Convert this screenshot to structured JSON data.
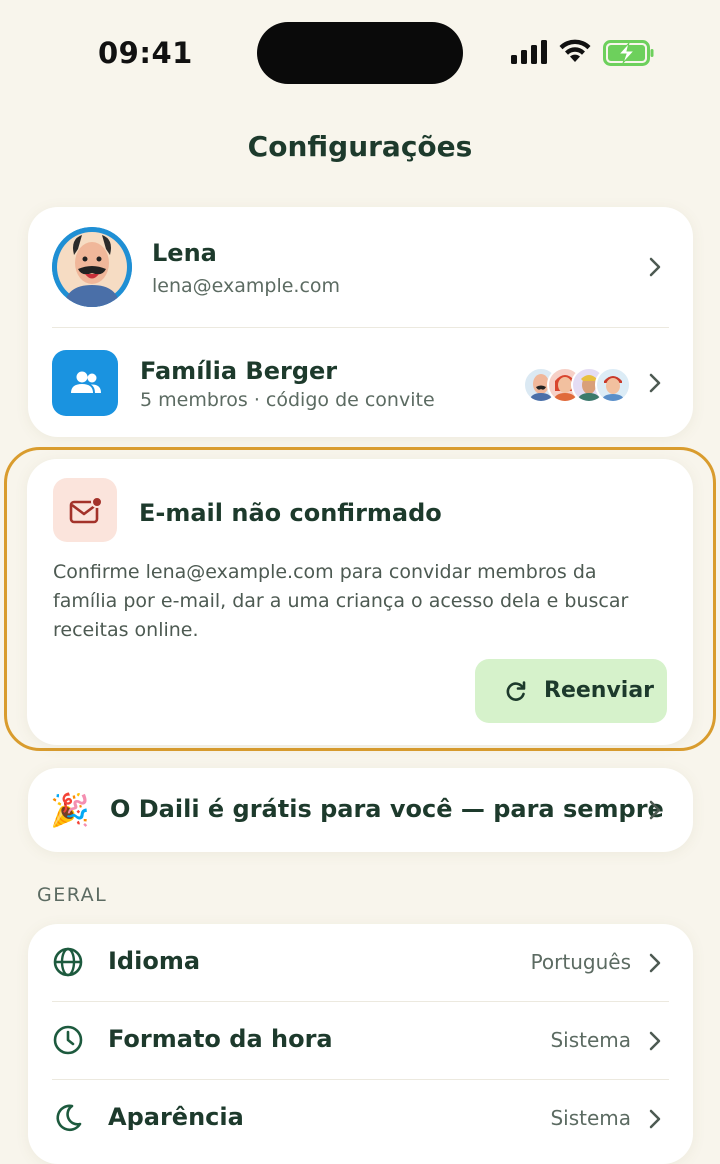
{
  "status_bar": {
    "time": "09:41"
  },
  "header": {
    "title": "Configurações"
  },
  "profile": {
    "name": "Lena",
    "email": "lena@example.com"
  },
  "family": {
    "name": "Família Berger",
    "subtitle": "5 membros · código de convite"
  },
  "email_warning": {
    "title": "E-mail não confirmado",
    "message": "Confirme lena@example.com para convidar membros da família por e-mail, dar a uma criança o acesso dela e buscar receitas online.",
    "resend_label": "Reenviar"
  },
  "promo": {
    "icon": "🎉",
    "text": "O Daili é grátis para você — para sempre"
  },
  "general": {
    "section_label": "GERAL",
    "rows": [
      {
        "icon": "globe-icon",
        "label": "Idioma",
        "value": "Português"
      },
      {
        "icon": "clock-icon",
        "label": "Formato da hora",
        "value": "Sistema"
      },
      {
        "icon": "moon-icon",
        "label": "Aparência",
        "value": "Sistema"
      }
    ]
  },
  "colors": {
    "background": "#f8f5ec",
    "primary_text": "#1d3a2c",
    "accent_blue": "#1a93e0",
    "warning_outline": "#d99c2e",
    "resend_bg": "#d6f2cb",
    "mail_badge_bg": "#fbe4dc"
  }
}
